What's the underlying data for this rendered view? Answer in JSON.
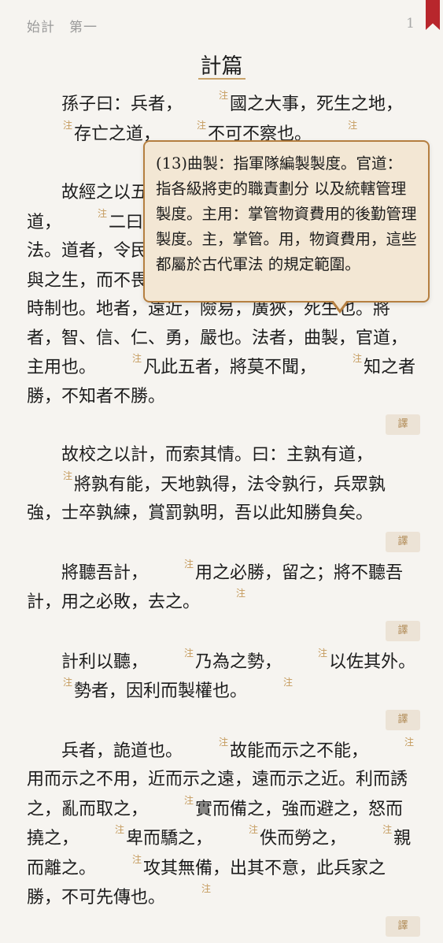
{
  "header": {
    "chapter": "始計　第一",
    "page_number": "1"
  },
  "title": "計篇",
  "note_marker": "注",
  "translate_label": "譯",
  "paragraphs": [
    {
      "segments": [
        "孫子曰：兵者，",
        "國之大事，死生之地，",
        "存亡之道，",
        "不可不察也。"
      ],
      "notes_after": [
        true,
        true,
        true,
        true
      ]
    },
    {
      "segments": [
        "故經之以五事，校之以計，而索其情：一曰",
        "道，",
        "二曰天，",
        "三曰地，四曰將，五曰法。道者，令",
        "民與上同意也，故可以與之死，可以與之生，而不畏危",
        "也。",
        "天者，陰陽、寒暑、時制也。地者，遠",
        "近，險易，廣狹，死生也。將者，智、信、仁、",
        "勇，嚴也。法者，曲製，官道，主用也。",
        "凡此五者，將莫不聞，",
        "知之者勝，不知者不勝。"
      ],
      "notes_after": [
        false,
        true,
        true,
        false,
        false,
        true,
        false,
        false,
        true,
        true,
        false
      ]
    },
    {
      "segments": [
        "故校之以計，而索其情。曰：主孰有道，",
        "將孰有能，天地孰得，法令孰行，兵眾孰強，士卒孰練，賞罰孰明，吾以此知勝負矣。"
      ],
      "notes_after": [
        true,
        false
      ]
    },
    {
      "segments": [
        "將聽吾計，",
        "用之必勝，留之；將不聽吾計，用之必敗，去之。"
      ],
      "notes_after": [
        true,
        true
      ]
    },
    {
      "segments": [
        "計利以聽，",
        "乃為之勢，",
        "以佐其外。",
        "勢者，因利而製權也。"
      ],
      "notes_after": [
        true,
        true,
        true,
        true
      ]
    },
    {
      "segments": [
        "兵者，詭道也。",
        "故能而示之不能，",
        "用而示之不用，近而示之遠，遠而示之近。利而誘之，亂而取之，",
        "實而備之，強而避之，怒而撓之，",
        "卑而驕之，",
        "佚而勞之，",
        "親而離之。",
        "攻其無備，出其不意，此兵家之勝，不可先傳也。"
      ],
      "notes_after": [
        true,
        true,
        true,
        true,
        true,
        true,
        true,
        true
      ]
    }
  ],
  "popup": {
    "text": "(13)曲製：指軍隊編製製度。官道：指各級將吏的職責劃分 以及統轄管理製度。主用：掌管物資費用的後勤管理 製度。主，掌管。用，物資費用，這些都屬於古代軍法 的規定範圍。"
  }
}
